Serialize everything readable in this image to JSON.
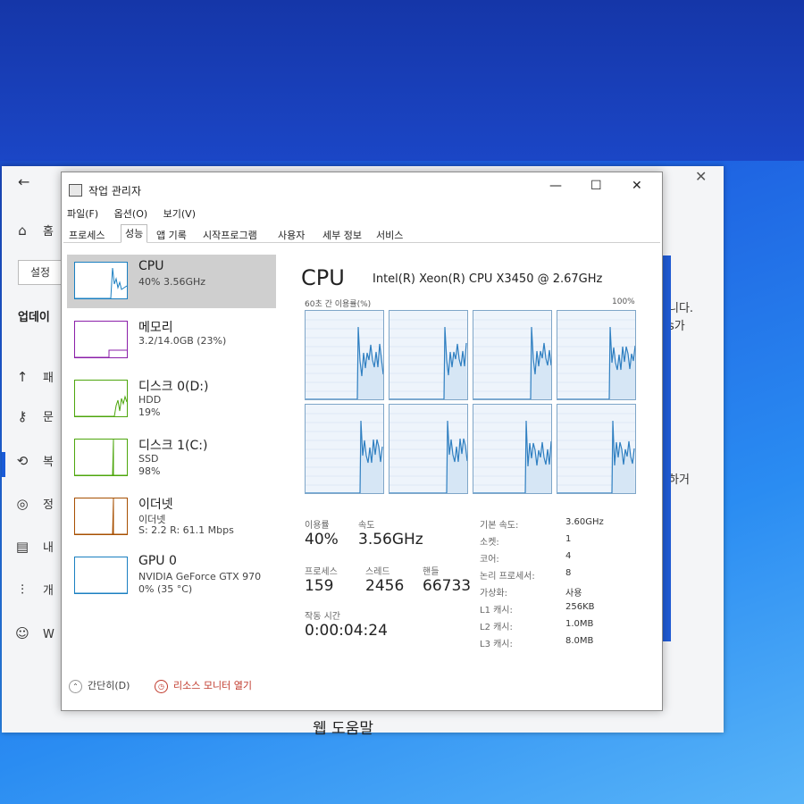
{
  "settings": {
    "btn_set": "설정",
    "update_label": "업데이",
    "home_label": "홈",
    "side_items": [
      {
        "icon": "↑",
        "label": "패"
      },
      {
        "icon": "⚷",
        "label": "문"
      },
      {
        "icon": "⟲",
        "label": "복"
      },
      {
        "icon": "◎",
        "label": "정"
      },
      {
        "icon": "▤",
        "label": "내"
      },
      {
        "icon": "⫶",
        "label": "개"
      },
      {
        "icon": "☺",
        "label": "W"
      }
    ],
    "right_text_1": "니다.",
    "right_text_2": "s가",
    "right_text_3": "하거",
    "web_help": "웹 도움말"
  },
  "taskmgr": {
    "title": "작업 관리자",
    "menus": [
      "파일(F)",
      "옵션(O)",
      "보기(V)"
    ],
    "tabs": [
      "프로세스",
      "성능",
      "앱 기록",
      "시작프로그램",
      "사용자",
      "세부 정보",
      "서비스"
    ],
    "active_tab": "성능",
    "resources": [
      {
        "name": "CPU",
        "line1": "40% 3.56GHz",
        "line2": "",
        "color": "#1a7fc1"
      },
      {
        "name": "메모리",
        "line1": "3.2/14.0GB (23%)",
        "line2": "",
        "color": "#8b1fa9"
      },
      {
        "name": "디스크 0(D:)",
        "line1": "HDD",
        "line2": "19%",
        "color": "#4da60c"
      },
      {
        "name": "디스크 1(C:)",
        "line1": "SSD",
        "line2": "98%",
        "color": "#4da60c"
      },
      {
        "name": "이더넷",
        "line1": "이더넷",
        "line2": "S: 2.2  R: 61.1 Mbps",
        "color": "#a74f01"
      },
      {
        "name": "GPU 0",
        "line1": "NVIDIA GeForce GTX 970",
        "line2": "0% (35 °C)",
        "color": "#1a7fc1"
      }
    ],
    "cpu": {
      "heading": "CPU",
      "model": "Intel(R) Xeon(R) CPU X3450 @ 2.67GHz",
      "graph_left_label": "60초 간 이용률(%)",
      "graph_right_label": "100%",
      "stats": {
        "util_label": "이용률",
        "util_value": "40%",
        "speed_label": "속도",
        "speed_value": "3.56GHz",
        "proc_label": "프로세스",
        "proc_value": "159",
        "thread_label": "스레드",
        "thread_value": "2456",
        "handle_label": "핸들",
        "handle_value": "66733",
        "uptime_label": "작동 시간",
        "uptime_value": "0:00:04:24"
      },
      "details": [
        {
          "k": "기본 속도:",
          "v": "3.60GHz"
        },
        {
          "k": "소켓:",
          "v": "1"
        },
        {
          "k": "코어:",
          "v": "4"
        },
        {
          "k": "논리 프로세서:",
          "v": "8"
        },
        {
          "k": "가상화:",
          "v": "사용"
        },
        {
          "k": "L1 캐시:",
          "v": "256KB"
        },
        {
          "k": "L2 캐시:",
          "v": "1.0MB"
        },
        {
          "k": "L3 캐시:",
          "v": "8.0MB"
        }
      ]
    },
    "footer": {
      "simple": "간단히(D)",
      "monitor": "리소스 모니터 열기"
    }
  }
}
